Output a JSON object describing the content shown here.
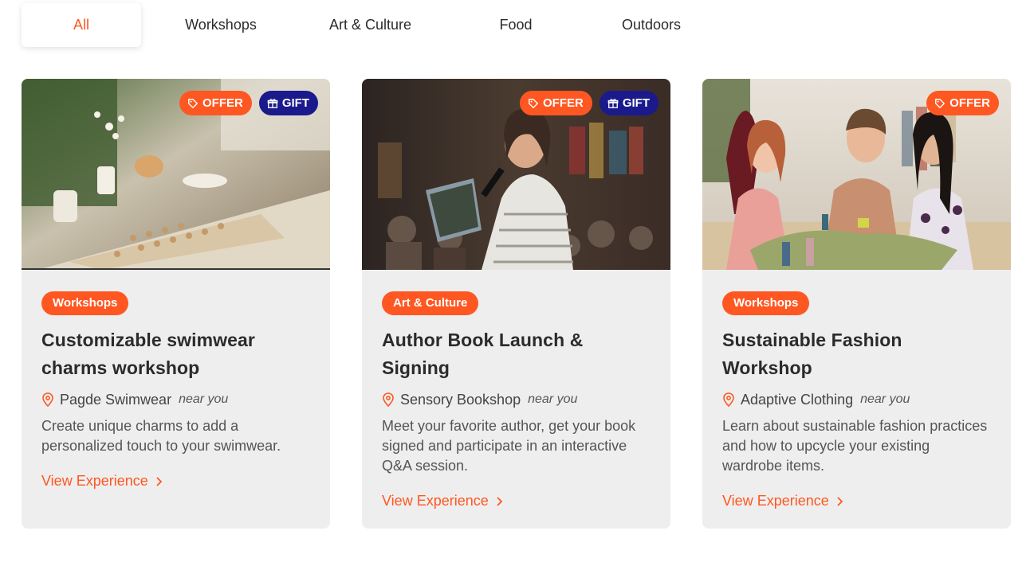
{
  "tabs": [
    {
      "label": "All",
      "active": true
    },
    {
      "label": "Workshops",
      "active": false
    },
    {
      "label": "Art & Culture",
      "active": false
    },
    {
      "label": "Food",
      "active": false
    },
    {
      "label": "Outdoors",
      "active": false
    }
  ],
  "colors": {
    "accent": "#ff5722",
    "gift": "#1a1a8c",
    "card_bg": "#eeeeee"
  },
  "cards": [
    {
      "image_icon": "workshop-table-photo",
      "badges": {
        "offer": "OFFER",
        "gift": "GIFT"
      },
      "category": "Workshops",
      "title": "Customizable swimwear charms workshop",
      "location": "Pagde Swimwear",
      "near": "near you",
      "description": "Create unique charms to add a personalized touch to your swimwear.",
      "cta": "View Experience"
    },
    {
      "image_icon": "author-reading-photo",
      "badges": {
        "offer": "OFFER",
        "gift": "GIFT"
      },
      "category": "Art & Culture",
      "title": "Author Book Launch & Signing",
      "location": "Sensory Bookshop",
      "near": "near you",
      "description": "Meet your favorite author, get your book signed and participate in an interactive Q&A session.",
      "cta": "View Experience"
    },
    {
      "image_icon": "fashion-workshop-photo",
      "badges": {
        "offer": "OFFER"
      },
      "category": "Workshops",
      "title": "Sustainable Fashion Workshop",
      "location": "Adaptive Clothing",
      "near": "near you",
      "description": "Learn about sustainable fashion practices and how to upcycle your existing wardrobe items.",
      "cta": "View Experience"
    }
  ]
}
